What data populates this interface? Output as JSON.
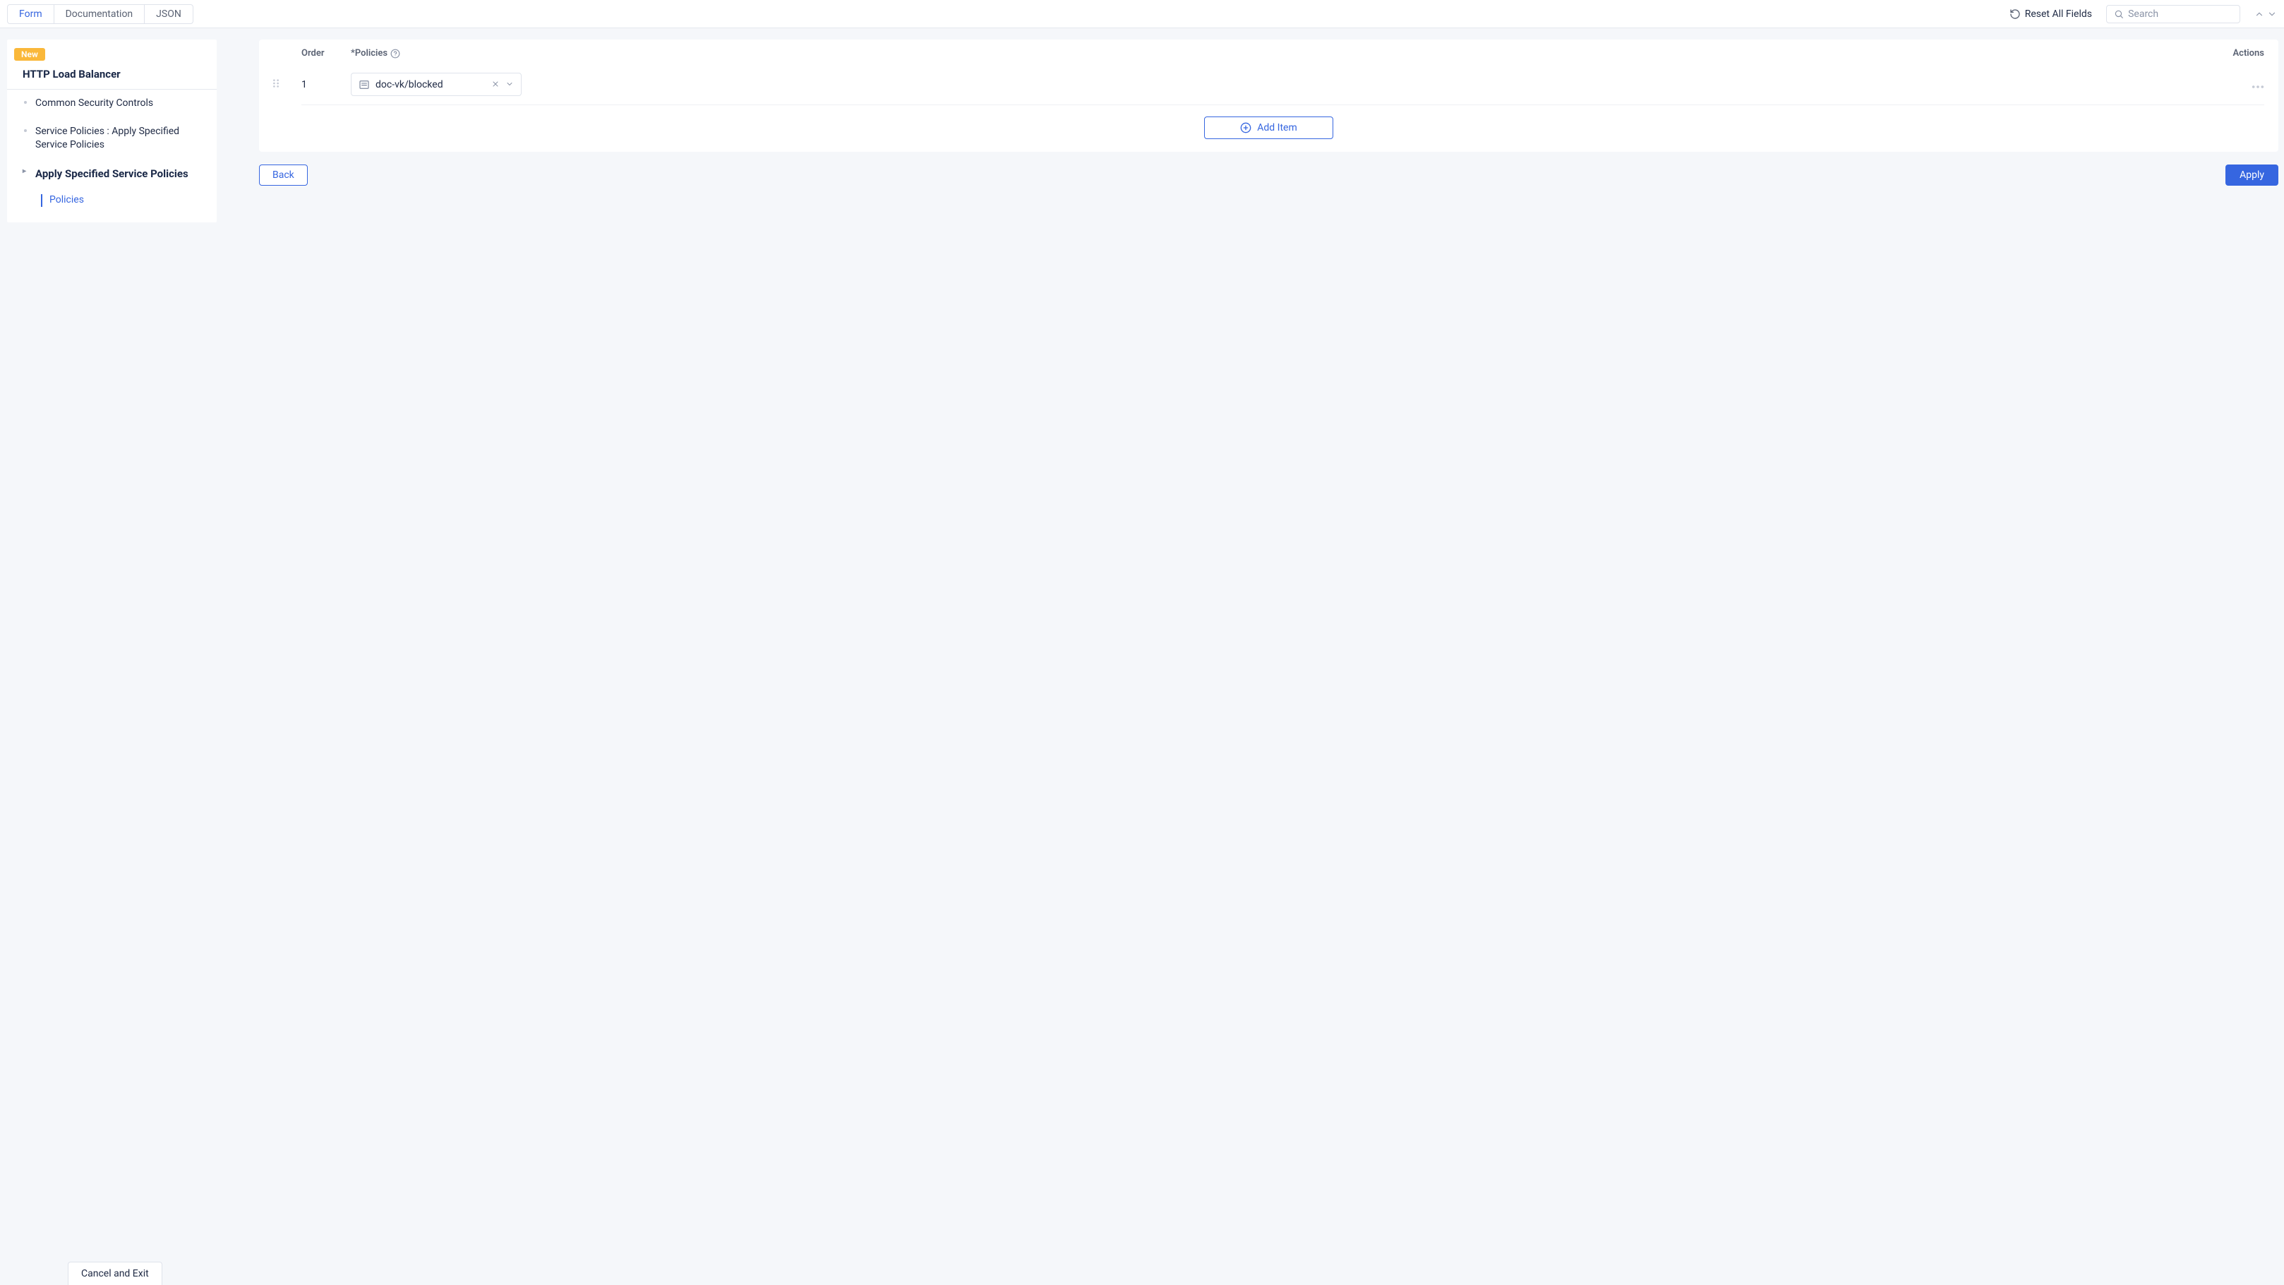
{
  "topbar": {
    "tabs": {
      "form": "Form",
      "documentation": "Documentation",
      "json": "JSON"
    },
    "reset_label": "Reset All Fields",
    "search_placeholder": "Search"
  },
  "sidebar": {
    "badge": "New",
    "title": "HTTP Load Balancer",
    "items": {
      "common_security": "Common Security Controls",
      "service_policies": "Service Policies : Apply Specified Service Policies",
      "apply_policies": "Apply Specified Service Policies",
      "policies": "Policies"
    }
  },
  "main": {
    "headers": {
      "order": "Order",
      "policies": "*Policies",
      "actions": "Actions"
    },
    "rows": [
      {
        "order": "1",
        "policy_value": "doc-vk/blocked"
      }
    ],
    "add_item_label": "Add Item",
    "back_label": "Back",
    "apply_label": "Apply"
  },
  "footer": {
    "cancel_exit": "Cancel and Exit"
  }
}
